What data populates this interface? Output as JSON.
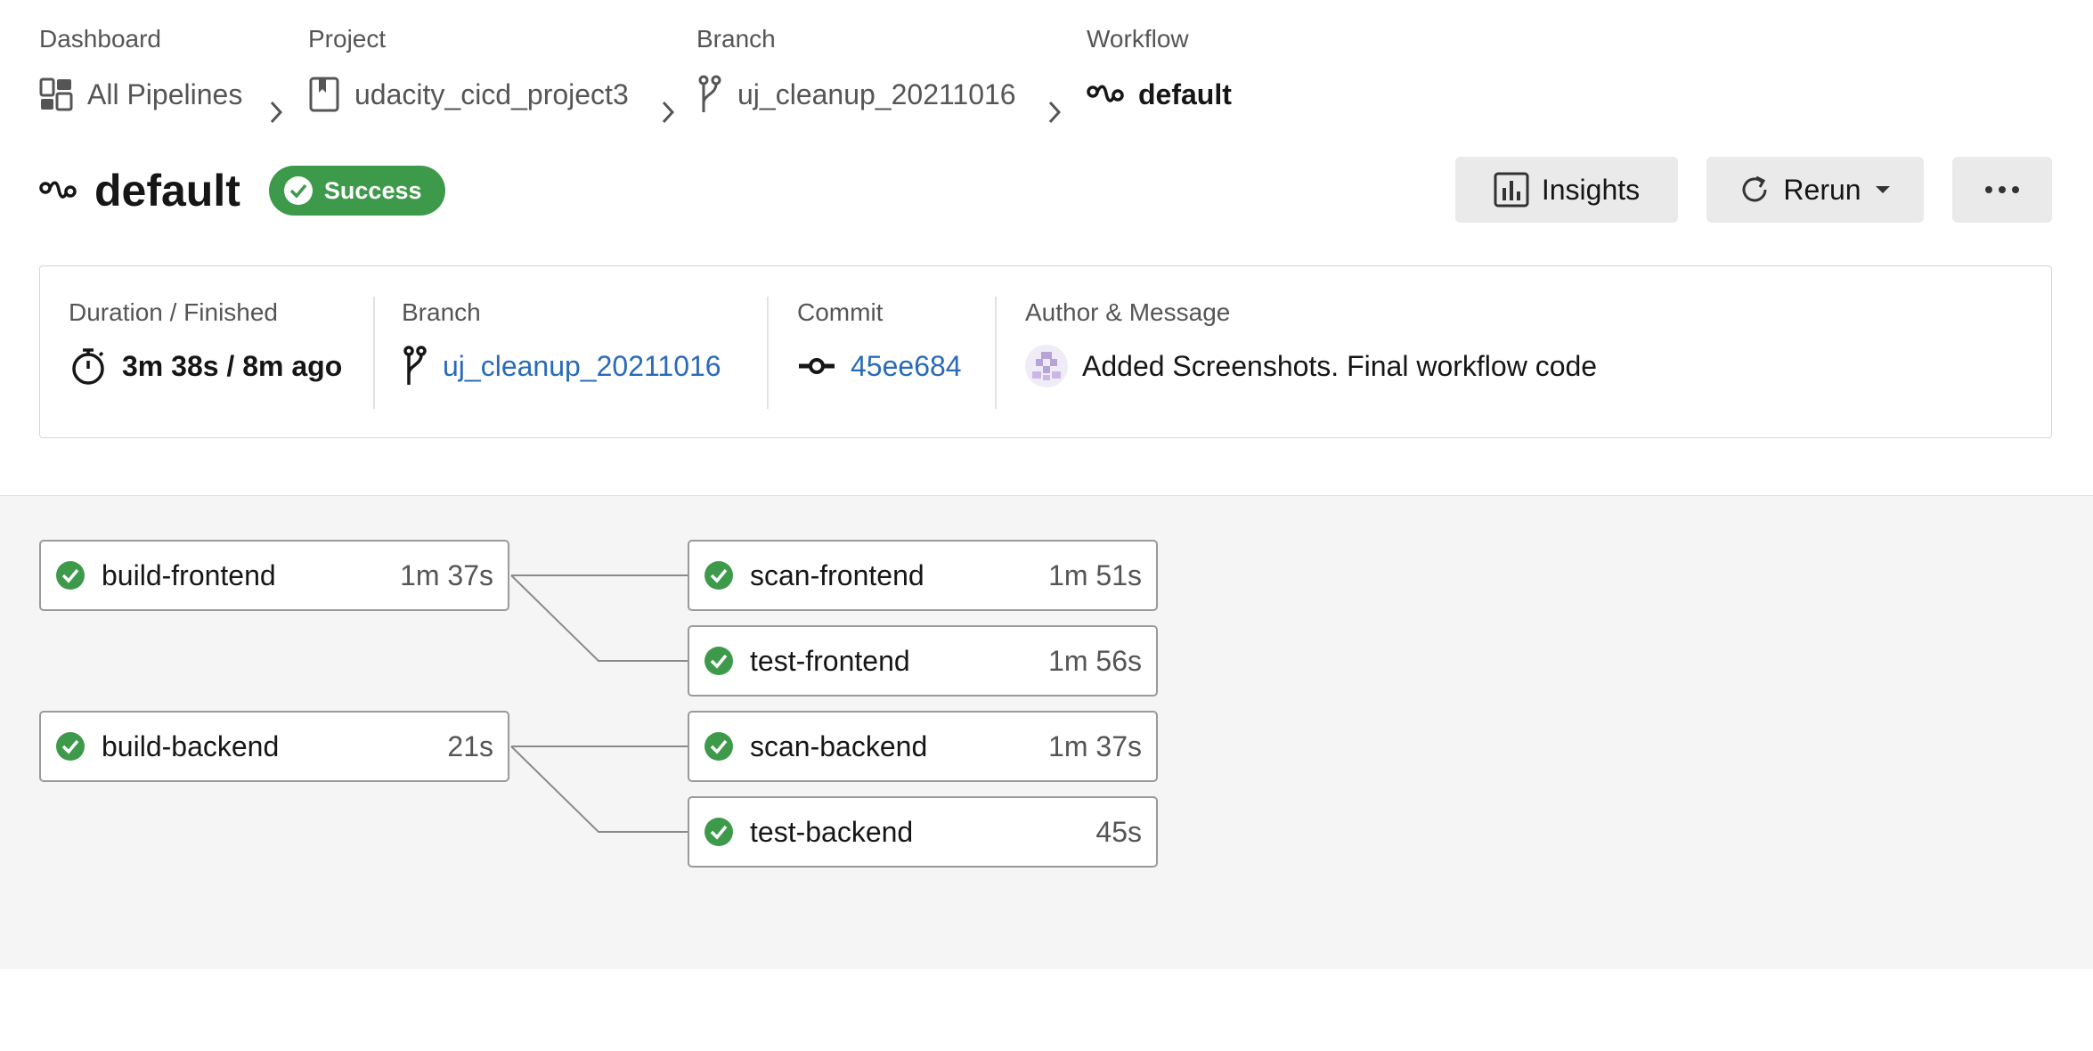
{
  "breadcrumbs": [
    {
      "label": "Dashboard",
      "value": "All Pipelines",
      "icon": "dashboard-icon"
    },
    {
      "label": "Project",
      "value": "udacity_cicd_project3",
      "icon": "bookmark-icon"
    },
    {
      "label": "Branch",
      "value": "uj_cleanup_20211016",
      "icon": "branch-icon"
    },
    {
      "label": "Workflow",
      "value": "default",
      "icon": "workflow-icon"
    }
  ],
  "workflow": {
    "title": "default",
    "status": "Success",
    "status_color": "#3e9a4b"
  },
  "actions": {
    "insights": "Insights",
    "rerun": "Rerun"
  },
  "info": {
    "duration_label": "Duration / Finished",
    "duration_value": "3m 38s / 8m ago",
    "branch_label": "Branch",
    "branch_value": "uj_cleanup_20211016",
    "commit_label": "Commit",
    "commit_value": "45ee684",
    "author_label": "Author & Message",
    "message": "Added Screenshots. Final workflow code",
    "link_color": "#2a6bb8"
  },
  "jobs": [
    {
      "name": "build-frontend",
      "duration": "1m 37s",
      "status": "success"
    },
    {
      "name": "scan-frontend",
      "duration": "1m 51s",
      "status": "success"
    },
    {
      "name": "test-frontend",
      "duration": "1m 56s",
      "status": "success"
    },
    {
      "name": "build-backend",
      "duration": "21s",
      "status": "success"
    },
    {
      "name": "scan-backend",
      "duration": "1m 37s",
      "status": "success"
    },
    {
      "name": "test-backend",
      "duration": "45s",
      "status": "success"
    }
  ]
}
